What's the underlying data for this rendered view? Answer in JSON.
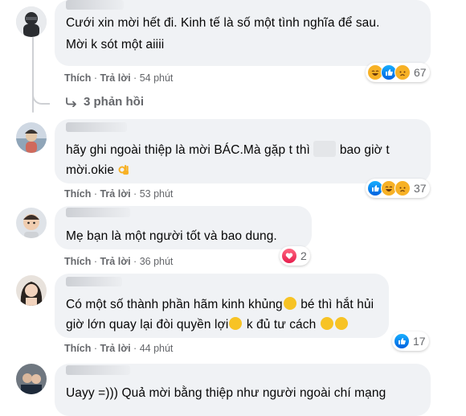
{
  "comments": [
    {
      "lines": [
        "Cưới xin mời hết đi. Kinh tế là số một tình nghĩa để sau.",
        "Mời k sót một aiiii"
      ],
      "actions": {
        "like": "Thích",
        "reply": "Trả lời",
        "time": "54 phút"
      },
      "reactions": [
        "haha-icon",
        "like-icon",
        "sad-icon"
      ],
      "reaction_count": "67",
      "replies": "3 phản hồi"
    },
    {
      "lines": [
        "hãy ghi ngoài thiệp là mời BÁC.Mà gặp t thì",
        "bao giờ t",
        "mời.okie"
      ],
      "actions": {
        "like": "Thích",
        "reply": "Trả lời",
        "time": "53 phút"
      },
      "reactions": [
        "like-icon",
        "haha-icon",
        "sad-icon"
      ],
      "reaction_count": "37"
    },
    {
      "lines": [
        "Mẹ bạn là một người tốt và bao dung."
      ],
      "actions": {
        "like": "Thích",
        "reply": "Trả lời",
        "time": "36 phút"
      },
      "reactions": [
        "heart-icon"
      ],
      "reaction_count": "2"
    },
    {
      "lines": [
        "Có một số thành phần hãm kinh khủng",
        "bé thì hắt hủi",
        "giờ lớn quay lại đòi quyền lợi",
        "k đủ tư cách"
      ],
      "actions": {
        "like": "Thích",
        "reply": "Trả lời",
        "time": "44 phút"
      },
      "reactions": [
        "like-icon"
      ],
      "reaction_count": "17"
    },
    {
      "lines": [
        "Uayy =))) Quả mời bằng thiệp như người ngoài chí mạng"
      ]
    }
  ],
  "separator": "·",
  "colors": {
    "bubble": "#f0f2f5",
    "meta": "#65676b",
    "like_blue": "#1877f2",
    "heart": "#f33e58"
  }
}
